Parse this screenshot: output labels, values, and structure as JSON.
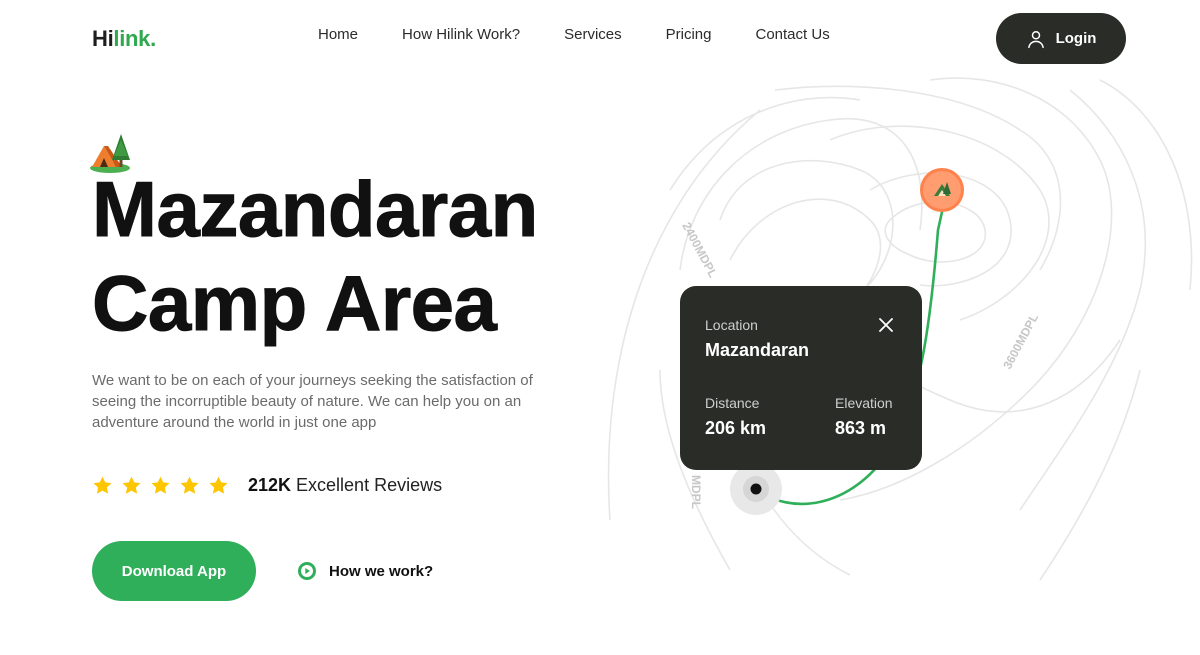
{
  "header": {
    "logo_part1": "Hi",
    "logo_part2": "link.",
    "nav": [
      "Home",
      "How Hilink Work?",
      "Services",
      "Pricing",
      "Contact Us"
    ],
    "login_label": "Login"
  },
  "hero": {
    "title_line1": "Mazandaran",
    "title_line2": "Camp Area",
    "description": "We want to be on each of your journeys seeking the satisfaction of seeing the incorruptible beauty of nature. We can help you on an adventure around the world in just one app",
    "rating_stars": 5,
    "reviews_count": "212K",
    "reviews_label": "Excellent Reviews",
    "download_label": "Download App",
    "how_label": "How we work?"
  },
  "map": {
    "contour_labels": [
      "2400MDPL",
      "3600MDPL",
      "MDPL"
    ]
  },
  "card": {
    "location_label": "Location",
    "location_value": "Mazandaran",
    "distance_label": "Distance",
    "distance_value": "206 km",
    "elevation_label": "Elevation",
    "elevation_value": "863 m"
  },
  "colors": {
    "brand_green": "#30af5b",
    "dark": "#292c27",
    "star": "#fec601",
    "pin": "#ff814c"
  }
}
